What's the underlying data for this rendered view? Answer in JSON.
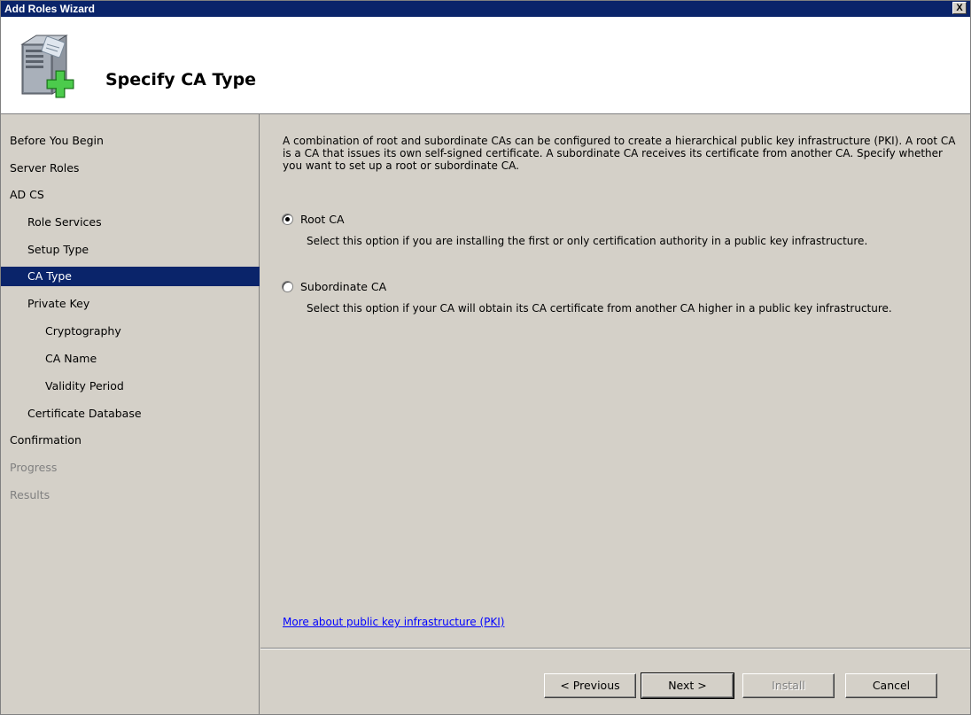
{
  "window": {
    "title": "Add Roles Wizard",
    "close_label": "X"
  },
  "header": {
    "title": "Specify CA Type"
  },
  "sidebar": {
    "items": [
      {
        "label": "Before You Begin",
        "level": 0,
        "state": "normal"
      },
      {
        "label": "Server Roles",
        "level": 0,
        "state": "normal"
      },
      {
        "label": "AD CS",
        "level": 0,
        "state": "normal"
      },
      {
        "label": "Role Services",
        "level": 1,
        "state": "normal"
      },
      {
        "label": "Setup Type",
        "level": 1,
        "state": "normal"
      },
      {
        "label": "CA Type",
        "level": 1,
        "state": "active"
      },
      {
        "label": "Private Key",
        "level": 1,
        "state": "normal"
      },
      {
        "label": "Cryptography",
        "level": 2,
        "state": "normal"
      },
      {
        "label": "CA Name",
        "level": 2,
        "state": "normal"
      },
      {
        "label": "Validity Period",
        "level": 2,
        "state": "normal"
      },
      {
        "label": "Certificate Database",
        "level": 1,
        "state": "normal"
      },
      {
        "label": "Confirmation",
        "level": 0,
        "state": "normal"
      },
      {
        "label": "Progress",
        "level": 0,
        "state": "disabled"
      },
      {
        "label": "Results",
        "level": 0,
        "state": "disabled"
      }
    ]
  },
  "main": {
    "description": "A combination of root and subordinate CAs can be configured to create a hierarchical public key infrastructure (PKI). A root CA is a CA that issues its own self-signed certificate. A subordinate CA receives its certificate from another CA. Specify whether you want to set up a root or subordinate CA.",
    "options": [
      {
        "label": "Root CA",
        "selected": true,
        "description": "Select this option if you are installing the first or only certification authority in a public key infrastructure."
      },
      {
        "label": "Subordinate CA",
        "selected": false,
        "description": "Select this option if your CA will obtain its CA certificate from another CA higher in a public key infrastructure."
      }
    ],
    "link": "More about public key infrastructure (PKI)"
  },
  "footer": {
    "previous": "< Previous",
    "next": "Next >",
    "install": "Install",
    "cancel": "Cancel"
  }
}
